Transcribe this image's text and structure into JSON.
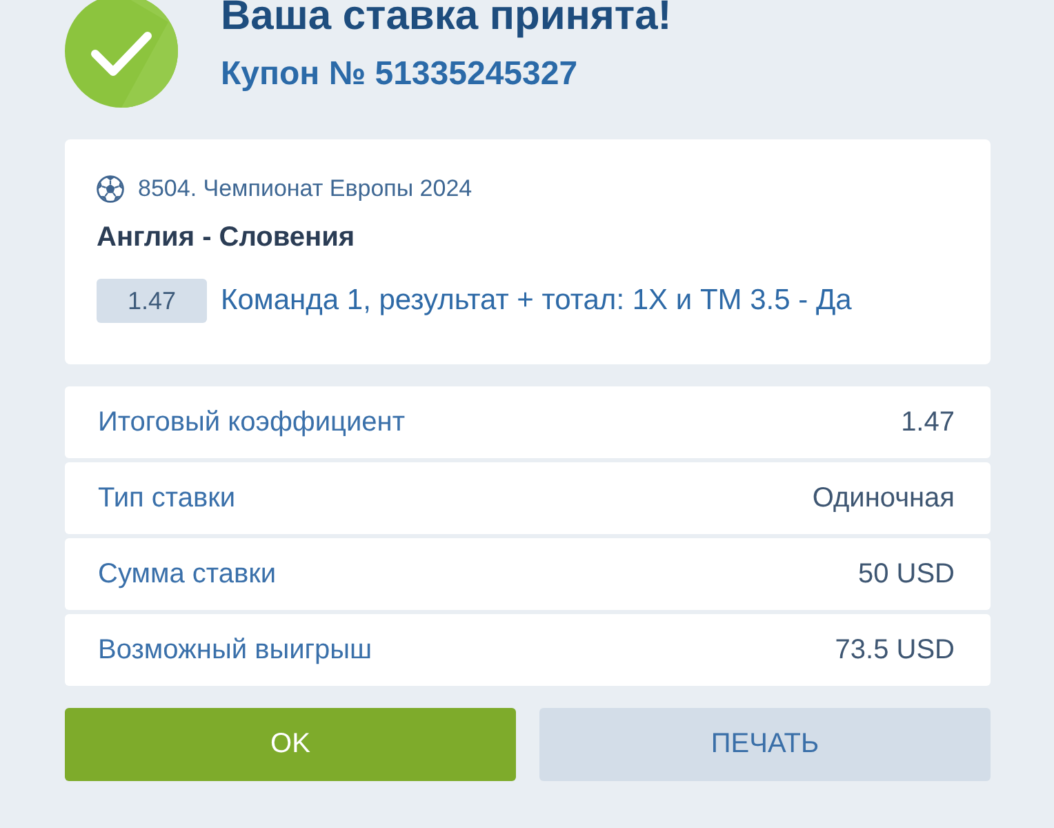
{
  "header": {
    "title": "Ваша ставка принята!",
    "coupon": "Купон № 51335245327"
  },
  "event": {
    "league": "8504. Чемпионат Европы 2024",
    "match": "Англия - Словения",
    "odds": "1.47",
    "selection": "Команда 1, результат + тотал: 1X и ТМ 3.5 - Да"
  },
  "summary": [
    {
      "label": "Итоговый коэффициент",
      "value": "1.47"
    },
    {
      "label": "Тип ставки",
      "value": "Одиночная"
    },
    {
      "label": "Сумма ставки",
      "value": "50 USD"
    },
    {
      "label": "Возможный выигрыш",
      "value": "73.5 USD"
    }
  ],
  "buttons": [
    {
      "label": "OK",
      "kind": "primary"
    },
    {
      "label": "ПЕЧАТЬ",
      "kind": "secondary"
    }
  ]
}
